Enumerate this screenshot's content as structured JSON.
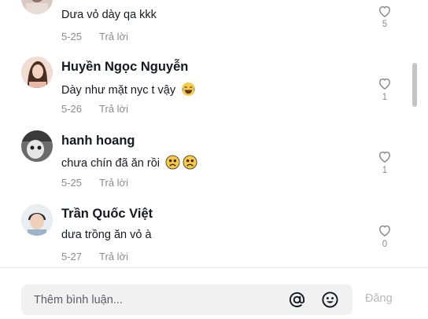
{
  "comments": [
    {
      "username": "",
      "text": "Dưa vỏ dày qa kkk",
      "date": "5-25",
      "reply_label": "Trả lời",
      "likes": "5",
      "emojis": []
    },
    {
      "username": "Huyền Ngọc Nguyễn",
      "text": "Dày như mặt nyc t vậy",
      "date": "5-26",
      "reply_label": "Trả lời",
      "likes": "1",
      "emojis": [
        "laughing-emoji"
      ]
    },
    {
      "username": "hanh hoang",
      "text": "chưa chín đã ăn rồi",
      "date": "5-25",
      "reply_label": "Trả lời",
      "likes": "1",
      "emojis": [
        "worried-emoji",
        "worried-emoji"
      ]
    },
    {
      "username": "Trần Quốc Việt",
      "text": "dưa trồng ăn vỏ à",
      "date": "5-27",
      "reply_label": "Trả lời",
      "likes": "0",
      "emojis": []
    }
  ],
  "input": {
    "placeholder": "Thêm bình luận...",
    "value": ""
  },
  "post_label": "Đăng",
  "icons": {
    "mention": "at-sign-icon",
    "emoji": "smiley-icon",
    "like": "heart-outline-icon"
  },
  "colors": {
    "text": "#161823",
    "muted": "#8a8b91",
    "input_bg": "#f1f1f2",
    "disabled_post": "#b9b9bd"
  }
}
